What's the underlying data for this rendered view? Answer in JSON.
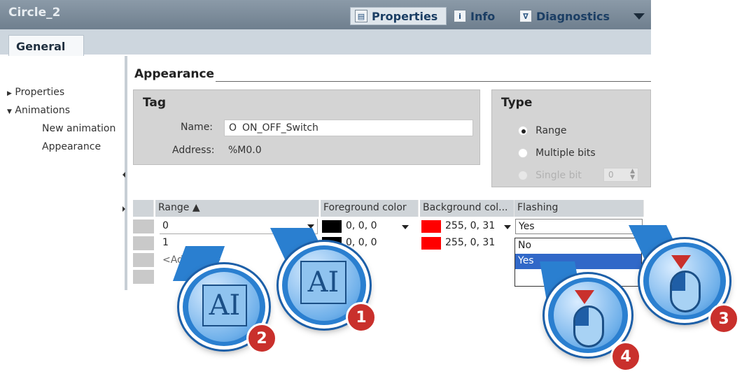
{
  "window": {
    "title": "Circle_2"
  },
  "top_tabs": {
    "properties": "Properties",
    "info": "Info",
    "diagnostics": "Diagnostics"
  },
  "subtab": {
    "general": "General"
  },
  "sidebar": {
    "items": [
      {
        "label": "Properties",
        "expanded": false
      },
      {
        "label": "Animations",
        "expanded": true
      },
      {
        "label": "New animation"
      },
      {
        "label": "Appearance"
      }
    ]
  },
  "section": {
    "title": "Appearance"
  },
  "tag": {
    "title": "Tag",
    "name_label": "Name:",
    "name_value": "ON_OFF_Switch",
    "name_prefix": "O",
    "address_label": "Address:",
    "address_value": "%M0.0"
  },
  "type": {
    "title": "Type",
    "options": [
      "Range",
      "Multiple bits",
      "Single bit"
    ],
    "selected": "Range",
    "single_bit_value": "0"
  },
  "table": {
    "headers": [
      "Range ▲",
      "Foreground color",
      "Background col...",
      "Flashing"
    ],
    "rows": [
      {
        "range": "0",
        "fg_color": "#000000",
        "fg": "0, 0, 0",
        "bg_color": "#ff0000",
        "bg": "255, 0, 31",
        "flashing": "Yes"
      },
      {
        "range": "1",
        "fg_color": "#000000",
        "fg": "0, 0, 0",
        "bg_color": "#ff0000",
        "bg": "255, 0, 31",
        "flashing": ""
      }
    ],
    "add_row": "<Add new>"
  },
  "flashing_dropdown": {
    "options": [
      "No",
      "Yes"
    ],
    "highlighted": "Yes"
  },
  "callouts": [
    {
      "number": "1",
      "icon": "text-cursor-icon"
    },
    {
      "number": "2",
      "icon": "text-cursor-icon"
    },
    {
      "number": "3",
      "icon": "mouse-left-click-icon"
    },
    {
      "number": "4",
      "icon": "mouse-left-click-icon"
    }
  ],
  "colors": {
    "accent": "#2a7fd0",
    "badge": "#c9302c",
    "selection": "#3168c8"
  }
}
